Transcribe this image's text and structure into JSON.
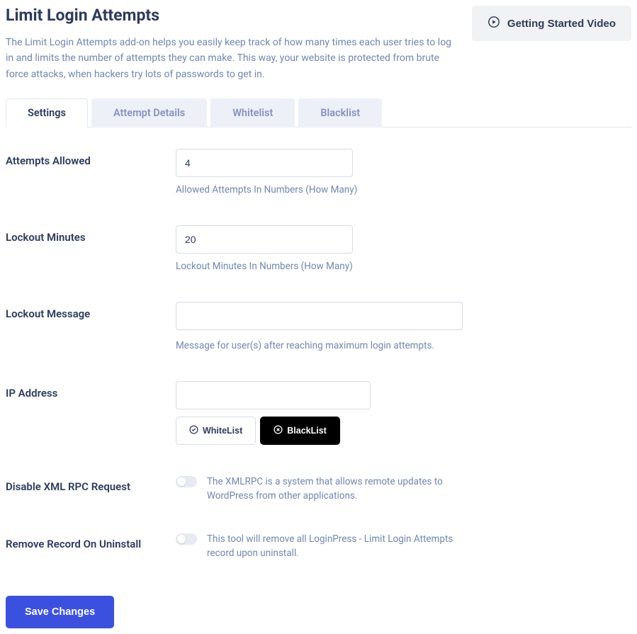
{
  "header": {
    "title": "Limit Login Attempts",
    "description": "The Limit Login Attempts add-on helps you easily keep track of how many times each user tries to log in and limits the number of attempts they can make. This way, your website is protected from brute force attacks, when hackers try lots of passwords to get in.",
    "video_button": "Getting Started Video"
  },
  "tabs": {
    "settings": "Settings",
    "attempt_details": "Attempt Details",
    "whitelist": "Whitelist",
    "blacklist": "Blacklist"
  },
  "fields": {
    "attempts_allowed": {
      "label": "Attempts Allowed",
      "value": "4",
      "help": "Allowed Attempts In Numbers (How Many)"
    },
    "lockout_minutes": {
      "label": "Lockout Minutes",
      "value": "20",
      "help": "Lockout Minutes In Numbers (How Many)"
    },
    "lockout_message": {
      "label": "Lockout Message",
      "value": "",
      "help": "Message for user(s) after reaching maximum login attempts."
    },
    "ip_address": {
      "label": "IP Address",
      "value": "",
      "whitelist_btn": "WhiteList",
      "blacklist_btn": "BlackList"
    },
    "disable_xmlrpc": {
      "label": "Disable XML RPC Request",
      "desc": "The XMLRPC is a system that allows remote updates to WordPress from other applications."
    },
    "remove_record": {
      "label": "Remove Record On Uninstall",
      "desc": "This tool will remove all LoginPress - Limit Login Attempts record upon uninstall."
    }
  },
  "save_button": "Save Changes"
}
